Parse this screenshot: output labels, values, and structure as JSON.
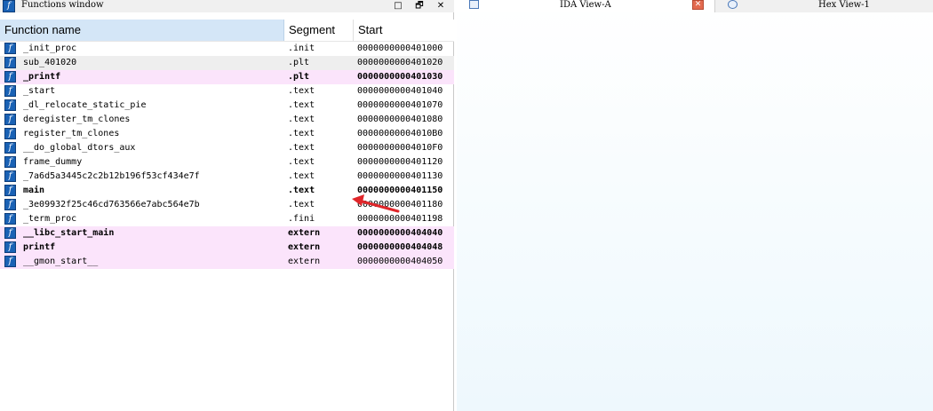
{
  "functions_window": {
    "title": "Functions window",
    "title_icon": "f",
    "buttons": {
      "minimize": "□",
      "restore": "🗗",
      "close": "✕"
    },
    "columns": {
      "name": "Function name",
      "segment": "Segment",
      "start": "Start"
    },
    "rows": [
      {
        "name": "_init_proc",
        "segment": ".init",
        "start": "0000000000401000",
        "style": "normal"
      },
      {
        "name": "sub_401020",
        "segment": ".plt",
        "start": "0000000000401020",
        "style": "alt"
      },
      {
        "name": "_printf",
        "segment": ".plt",
        "start": "0000000000401030",
        "style": "import"
      },
      {
        "name": "_start",
        "segment": ".text",
        "start": "0000000000401040",
        "style": "normal"
      },
      {
        "name": "_dl_relocate_static_pie",
        "segment": ".text",
        "start": "0000000000401070",
        "style": "normal"
      },
      {
        "name": "deregister_tm_clones",
        "segment": ".text",
        "start": "0000000000401080",
        "style": "normal"
      },
      {
        "name": "register_tm_clones",
        "segment": ".text",
        "start": "00000000004010B0",
        "style": "normal"
      },
      {
        "name": "__do_global_dtors_aux",
        "segment": ".text",
        "start": "00000000004010F0",
        "style": "normal"
      },
      {
        "name": "frame_dummy",
        "segment": ".text",
        "start": "0000000000401120",
        "style": "normal"
      },
      {
        "name": "_7a6d5a3445c2c2b12b196f53cf434e7f",
        "segment": ".text",
        "start": "0000000000401130",
        "style": "normal"
      },
      {
        "name": "main",
        "segment": ".text",
        "start": "0000000000401150",
        "style": "bold"
      },
      {
        "name": "_3e09932f25c46cd763566e7abc564e7b",
        "segment": ".text",
        "start": "0000000000401180",
        "style": "normal"
      },
      {
        "name": "_term_proc",
        "segment": ".fini",
        "start": "0000000000401198",
        "style": "normal"
      },
      {
        "name": "__libc_start_main",
        "segment": "extern",
        "start": "0000000000404040",
        "style": "import"
      },
      {
        "name": "printf",
        "segment": "extern",
        "start": "0000000000404048",
        "style": "import"
      },
      {
        "name": "__gmon_start__",
        "segment": "extern",
        "start": "0000000000404050",
        "style": "import-normal"
      }
    ]
  },
  "tabs": {
    "ida_view": {
      "label": "IDA View-A",
      "close": "✕"
    },
    "hex_view": {
      "label": "Hex View-1"
    }
  },
  "colors": {
    "import_row": "#fbe4fb",
    "alt_row": "#eeeeee",
    "header_selected": "#d4e6f7",
    "function_icon": "#1a62b5",
    "annotation_arrow": "#e0262a"
  }
}
